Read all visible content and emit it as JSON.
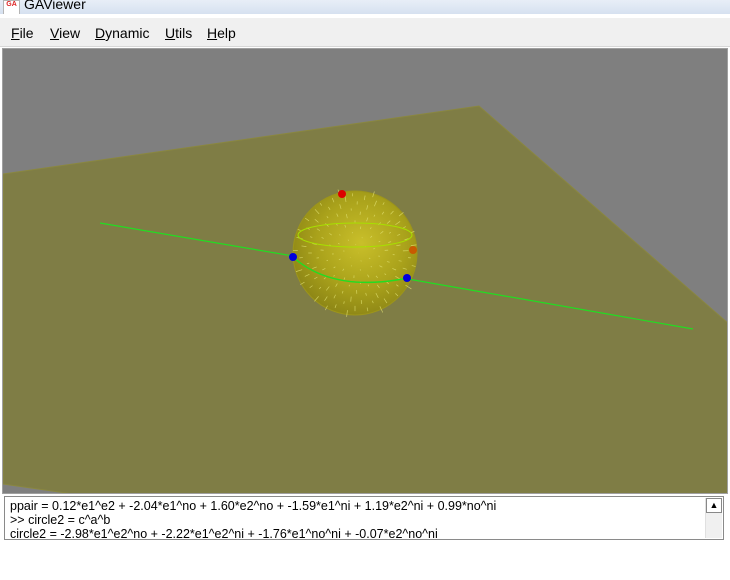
{
  "window": {
    "app_icon": "GA",
    "title": "GAViewer"
  },
  "menu": {
    "file": {
      "acc": "F",
      "rest": "ile"
    },
    "view": {
      "acc": "V",
      "rest": "iew"
    },
    "dynamic": {
      "acc": "D",
      "rest": "ynamic"
    },
    "utils": {
      "acc": "U",
      "rest": "tils"
    },
    "help": {
      "acc": "H",
      "rest": "elp"
    }
  },
  "viewport": {
    "background_color": "#7f7f7f",
    "plane_color": "#7f7d45",
    "sphere_color": "#aaa21b",
    "line_color": "#22dd22",
    "point_colors": [
      "#dd0000",
      "#0000dd",
      "#0000dd",
      "#c85a00"
    ]
  },
  "console": {
    "lines": [
      "ppair = 0.12*e1^e2 + -2.04*e1^no + 1.60*e2^no + -1.59*e1^ni + 1.19*e2^ni + 0.99*no^ni",
      ">> circle2 = c^a^b",
      "circle2 = -2.98*e1^e2^no + -2.22*e1^e2^ni + -1.76*e1^no^ni + -0.07*e2^no^ni"
    ],
    "scroll_up_icon": "▲"
  }
}
